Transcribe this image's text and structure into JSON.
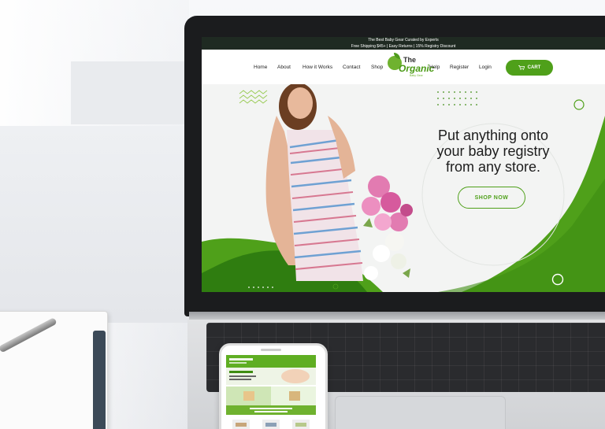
{
  "screen": {
    "topbar": {
      "line1": "The Best Baby Gear Curated by Experts",
      "line2": "Free Shipping $45+ | Easy Returns | 15% Registry Discount"
    },
    "nav": {
      "left": [
        "Home",
        "About",
        "How it Works",
        "Contact",
        "Shop"
      ],
      "right": [
        "Help",
        "Register",
        "Login"
      ],
      "cart_label": "CART"
    },
    "logo": {
      "the": "The",
      "organic": "Organic",
      "sub": "Baby Gear"
    },
    "hero": {
      "headline_line1": "Put anything onto",
      "headline_line2": "your baby registry",
      "headline_line3": "from any store.",
      "cta_label": "SHOP NOW"
    }
  },
  "colors": {
    "brand_green": "#4fa01a",
    "dark_green": "#2f7d10",
    "topbar_bg": "#1f2a22"
  },
  "icons": [
    "cart-icon",
    "logo-leaf-icon"
  ]
}
